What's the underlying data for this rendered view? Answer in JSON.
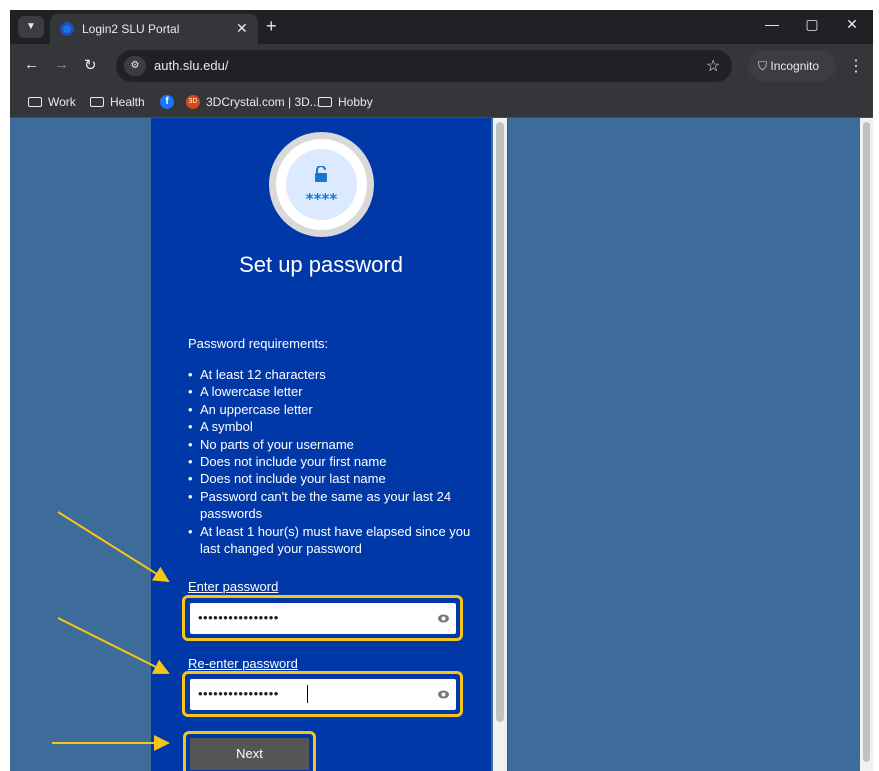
{
  "browser": {
    "tab_title": "Login2 SLU Portal",
    "url": "auth.slu.edu/",
    "incognito_label": "Incognito"
  },
  "bookmarks": [
    {
      "label": "Work",
      "icon": "folder-icon"
    },
    {
      "label": "Health",
      "icon": "folder-icon"
    },
    {
      "label": "",
      "icon": "facebook-icon"
    },
    {
      "label": "3DCrystal.com | 3D...",
      "icon": "3dcrystal-icon"
    },
    {
      "label": "Hobby",
      "icon": "folder-icon"
    }
  ],
  "page": {
    "title": "Set up password",
    "requirements_heading": "Password requirements:",
    "requirements": [
      "At least 12 characters",
      "A lowercase letter",
      "An uppercase letter",
      "A symbol",
      "No parts of your username",
      "Does not include your first name",
      "Does not include your last name",
      "Password can't be the same as your last 24 passwords",
      "At least 1 hour(s) must have elapsed since you last changed your password"
    ],
    "enter_password_label": "Enter password",
    "enter_password_value": "••••••••••••••••",
    "reenter_password_label": "Re-enter password",
    "reenter_password_value": "••••••••••••••••",
    "next_label": "Next",
    "icon_text": "****"
  },
  "colors": {
    "panel": "#0038a8",
    "background": "#3d6b9a",
    "highlight": "#f5c518"
  }
}
